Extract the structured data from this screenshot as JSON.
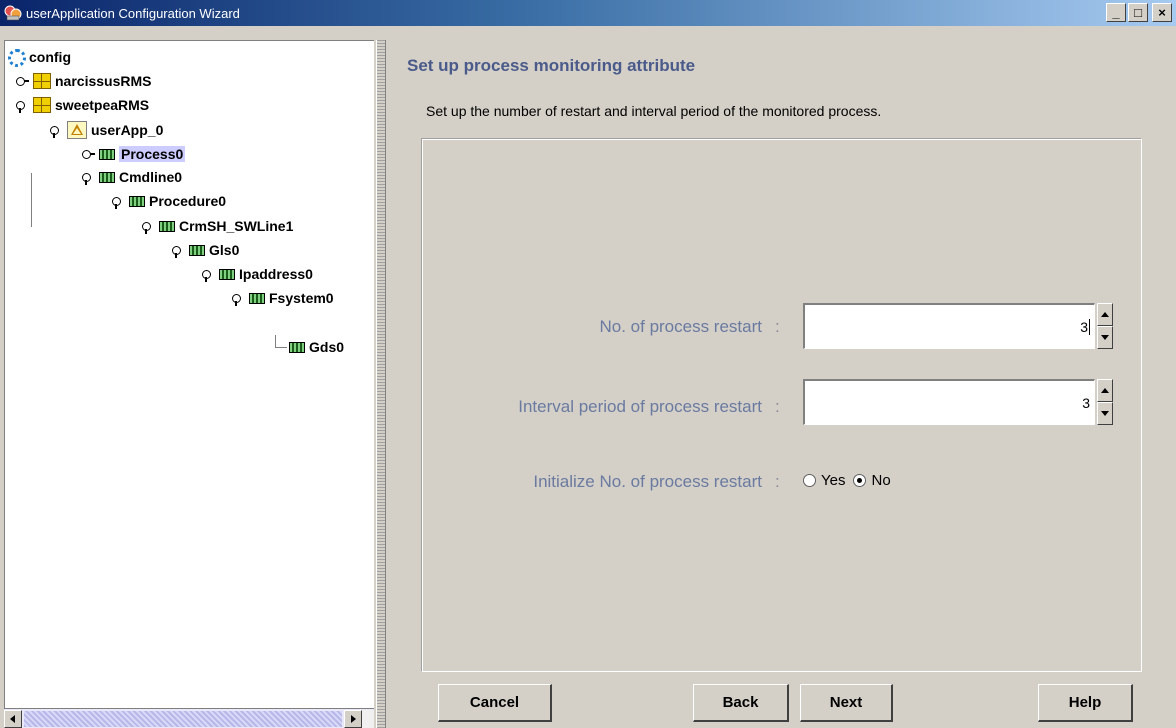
{
  "window": {
    "title": "userApplication Configuration Wizard",
    "minimize": "_",
    "maximize": "□",
    "close": "×"
  },
  "tree": {
    "items": [
      {
        "label": "config",
        "icon": "config-icon",
        "level": 0
      },
      {
        "label": "narcissusRMS",
        "icon": "server-icon",
        "level": 0,
        "state": "collapsed"
      },
      {
        "label": "sweetpeaRMS",
        "icon": "server-icon",
        "level": 0,
        "state": "expanded"
      },
      {
        "label": "userApp_0",
        "icon": "userapp-icon",
        "level": 1,
        "state": "expanded"
      },
      {
        "label": "Process0",
        "icon": "resource-icon",
        "level": 2,
        "state": "collapsed",
        "selected": true
      },
      {
        "label": "Cmdline0",
        "icon": "resource-icon",
        "level": 2,
        "state": "expanded"
      },
      {
        "label": "Procedure0",
        "icon": "resource-icon",
        "level": 3,
        "state": "expanded"
      },
      {
        "label": "CrmSH_SWLine1",
        "icon": "resource-icon",
        "level": 4,
        "state": "expanded"
      },
      {
        "label": "Gls0",
        "icon": "resource-icon",
        "level": 5,
        "state": "expanded"
      },
      {
        "label": "Ipaddress0",
        "icon": "resource-icon",
        "level": 6,
        "state": "expanded"
      },
      {
        "label": "Fsystem0",
        "icon": "resource-icon",
        "level": 7,
        "state": "expanded"
      },
      {
        "label": "Gds0",
        "icon": "resource-icon",
        "level": 8
      }
    ]
  },
  "content": {
    "title": "Set up process monitoring attribute",
    "description": "Set up the number of restart and interval period of the monitored process.",
    "fields": {
      "restart_count": {
        "label": "No. of process restart",
        "colon": ":",
        "value": "3"
      },
      "interval": {
        "label": "Interval period of process restart",
        "colon": ":",
        "value": "3"
      },
      "initialize": {
        "label": "Initialize No. of process restart",
        "colon": ":",
        "options": [
          {
            "label": "Yes",
            "checked": false
          },
          {
            "label": "No",
            "checked": true
          }
        ]
      }
    }
  },
  "buttons": {
    "cancel": "Cancel",
    "back": "Back",
    "next": "Next",
    "help": "Help"
  }
}
